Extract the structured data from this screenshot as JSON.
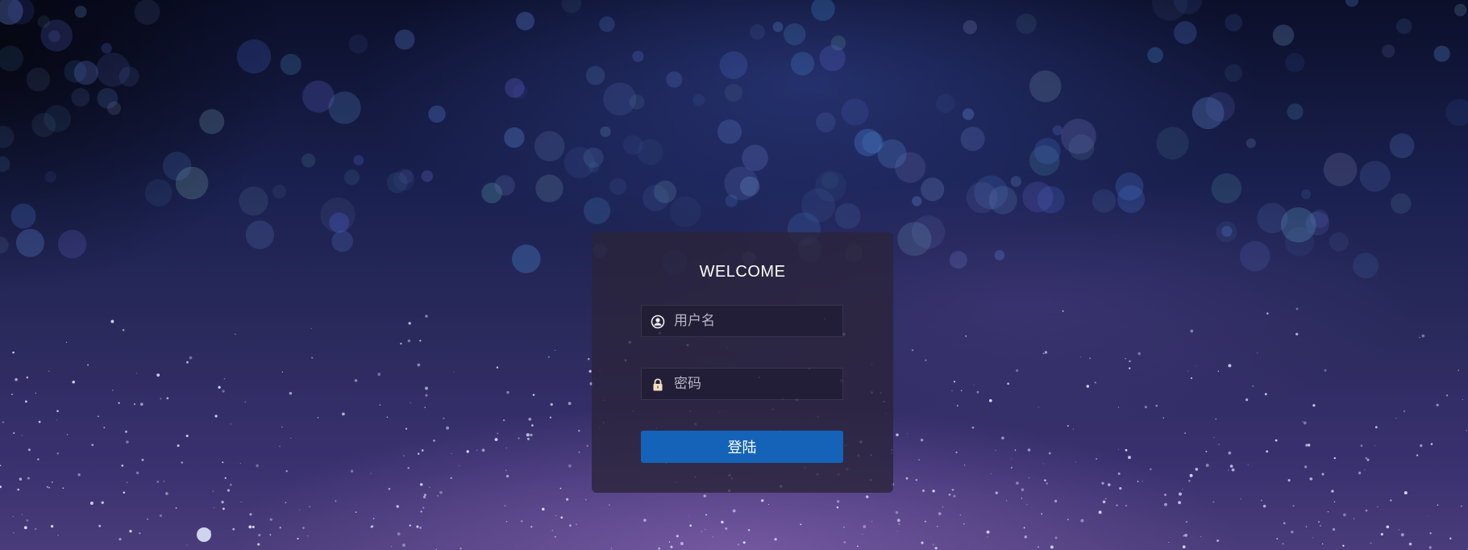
{
  "login": {
    "title": "WELCOME",
    "username": {
      "placeholder": "用户名",
      "value": "",
      "icon": "user-icon"
    },
    "password": {
      "placeholder": "密码",
      "value": "",
      "icon": "lock-icon"
    },
    "submit_label": "登陆"
  },
  "colors": {
    "accent": "#1463b8",
    "panel": "#2a243a",
    "text": "#ffffff"
  }
}
